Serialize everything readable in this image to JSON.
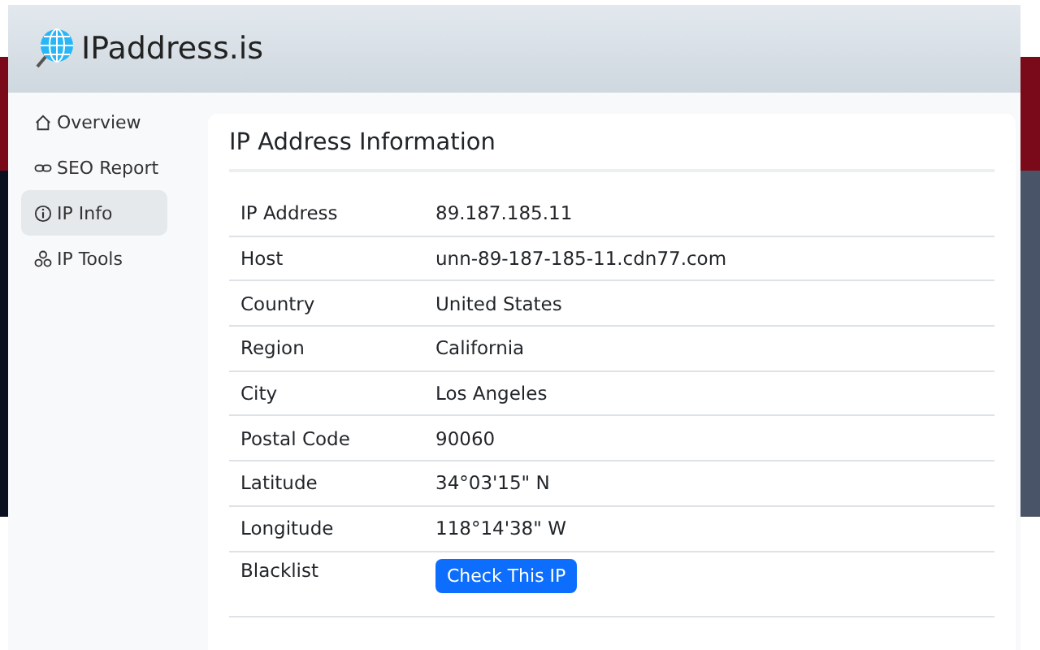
{
  "header": {
    "title": "IPaddress.is"
  },
  "sidebar": {
    "items": [
      {
        "label": "Overview",
        "kind": "home",
        "selected": false
      },
      {
        "label": "SEO Report",
        "kind": "link",
        "selected": false
      },
      {
        "label": "IP Info",
        "kind": "info",
        "selected": true
      },
      {
        "label": "IP Tools",
        "kind": "tools",
        "selected": false
      }
    ]
  },
  "card": {
    "title": "IP Address Information",
    "rows": [
      {
        "label": "IP Address",
        "value": "89.187.185.11",
        "kind": "text"
      },
      {
        "label": "Host",
        "value": "unn-89-187-185-11.cdn77.com",
        "kind": "text"
      },
      {
        "label": "Country",
        "value": "United States",
        "kind": "text"
      },
      {
        "label": "Region",
        "value": "California",
        "kind": "text"
      },
      {
        "label": "City",
        "value": "Los Angeles",
        "kind": "text"
      },
      {
        "label": "Postal Code",
        "value": "90060",
        "kind": "text"
      },
      {
        "label": "Latitude",
        "value": "34°03'15\" N",
        "kind": "text"
      },
      {
        "label": "Longitude",
        "value": "118°14'38\" W",
        "kind": "text"
      },
      {
        "label": "Blacklist",
        "value": "Check This IP",
        "kind": "button"
      }
    ]
  }
}
